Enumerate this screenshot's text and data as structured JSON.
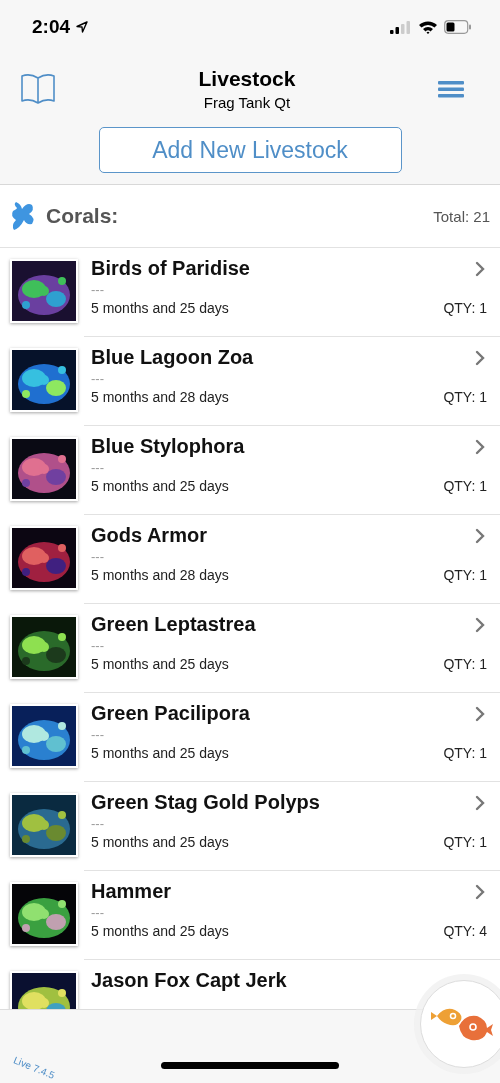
{
  "status_bar": {
    "time": "2:04"
  },
  "header": {
    "title": "Livestock",
    "subtitle": "Frag Tank Qt",
    "add_button": "Add New Livestock"
  },
  "section": {
    "title": "Corals:",
    "total": "Total: 21"
  },
  "items": [
    {
      "name": "Birds of Paridise",
      "note": "---",
      "age": "5 months and 25 days",
      "qty": "QTY: 1"
    },
    {
      "name": "Blue Lagoon Zoa",
      "note": "---",
      "age": "5 months and 28 days",
      "qty": "QTY: 1"
    },
    {
      "name": "Blue Stylophora",
      "note": "---",
      "age": "5 months and 25 days",
      "qty": "QTY: 1"
    },
    {
      "name": "Gods Armor",
      "note": "---",
      "age": "5 months and 28 days",
      "qty": "QTY: 1"
    },
    {
      "name": "Green Leptastrea",
      "note": "---",
      "age": "5 months and 25 days",
      "qty": "QTY: 1"
    },
    {
      "name": "Green Pacilipora",
      "note": "---",
      "age": "5 months and 25 days",
      "qty": "QTY: 1"
    },
    {
      "name": "Green Stag Gold Polyps",
      "note": "---",
      "age": "5 months and 25 days",
      "qty": "QTY: 1"
    },
    {
      "name": "Hammer",
      "note": "---",
      "age": "5 months and 25 days",
      "qty": "QTY: 4"
    },
    {
      "name": "Jason Fox Capt Jerk"
    }
  ],
  "footer": {
    "version": "Live 7.4.5"
  }
}
